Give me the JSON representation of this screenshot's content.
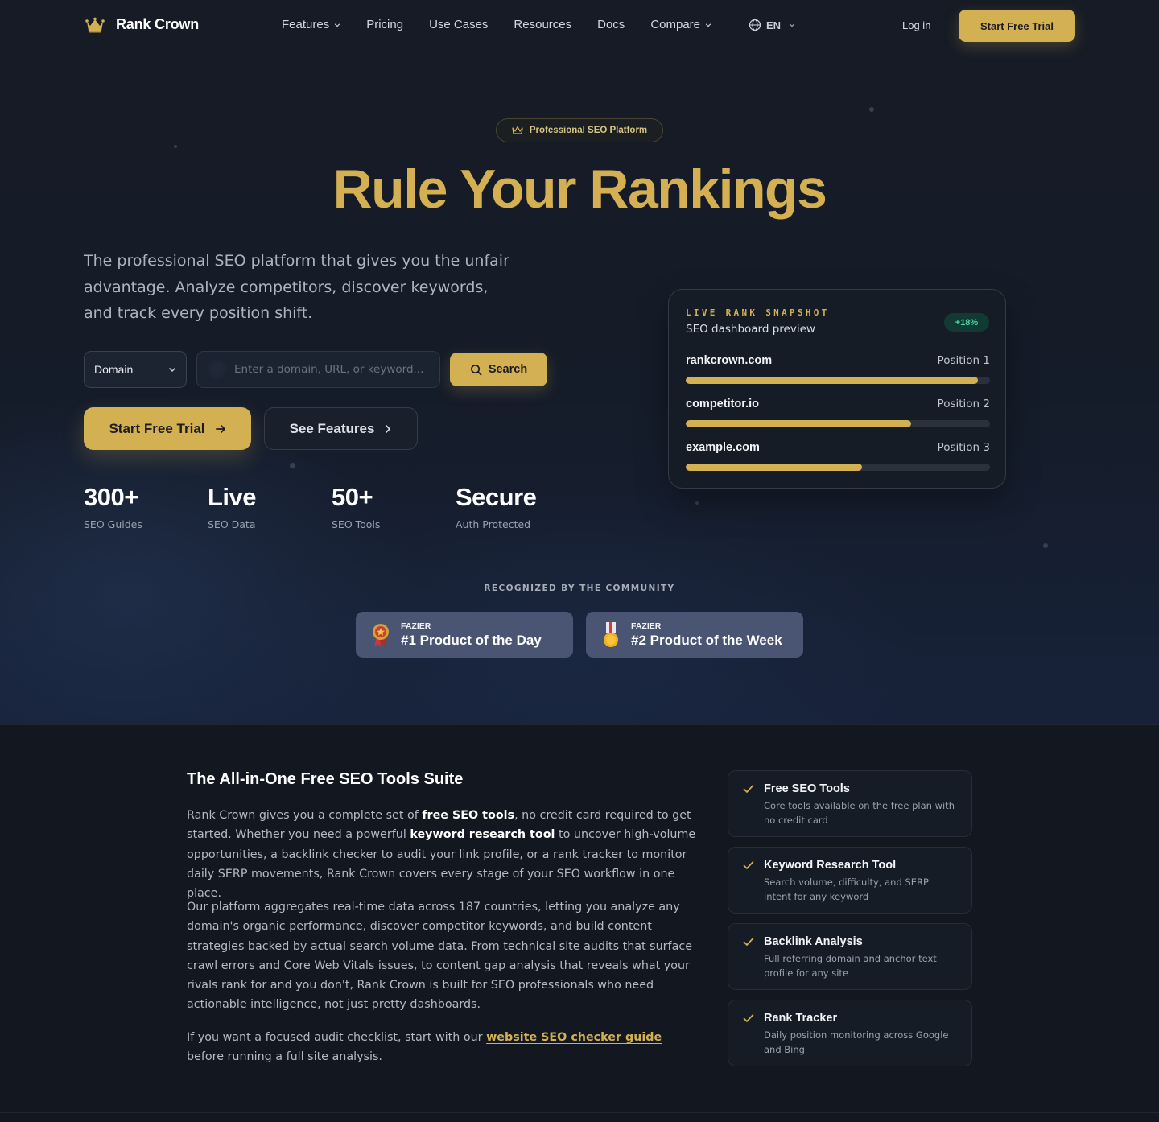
{
  "nav": {
    "brand": "Rank Crown",
    "links": [
      {
        "label": "Features",
        "dropdown": true
      },
      {
        "label": "Pricing",
        "dropdown": false
      },
      {
        "label": "Use Cases",
        "dropdown": false
      },
      {
        "label": "Resources",
        "dropdown": false
      },
      {
        "label": "Docs",
        "dropdown": false
      },
      {
        "label": "Compare",
        "dropdown": true
      }
    ],
    "language": "EN",
    "login": "Log in",
    "cta": "Start Free Trial"
  },
  "hero": {
    "badge": "Professional SEO Platform",
    "title": "Rule Your Rankings",
    "subtitle": "The professional SEO platform that gives you the unfair advantage. Analyze competitors, discover keywords, and track every position shift.",
    "search": {
      "type_selected": "Domain",
      "placeholder": "Enter a domain, URL, or keyword...",
      "button": "Search"
    },
    "cta_primary": "Start Free Trial",
    "cta_secondary": "See Features",
    "stats": [
      {
        "value": "300+",
        "label": "SEO Guides"
      },
      {
        "value": "Live",
        "label": "SEO Data"
      },
      {
        "value": "50+",
        "label": "SEO Tools"
      },
      {
        "value": "Secure",
        "label": "Auth Protected"
      }
    ]
  },
  "snapshot": {
    "kicker": "LIVE RANK SNAPSHOT",
    "title": "SEO dashboard preview",
    "change": "+18%",
    "rows": [
      {
        "domain": "rankcrown.com",
        "position": "Position 1",
        "score": 0.96
      },
      {
        "domain": "competitor.io",
        "position": "Position 2",
        "score": 0.74
      },
      {
        "domain": "example.com",
        "position": "Position 3",
        "score": 0.58
      }
    ]
  },
  "recognition": {
    "heading": "RECOGNIZED BY THE COMMUNITY",
    "awards": [
      {
        "org": "FAZIER",
        "title": "#1 Product of the Day",
        "icon": "award-rosette-icon"
      },
      {
        "org": "FAZIER",
        "title": "#2 Product of the Week",
        "icon": "medal-icon"
      }
    ]
  },
  "suite": {
    "title": "The All-in-One Free SEO Tools Suite",
    "p1": {
      "t1": "Rank Crown gives you a complete set of ",
      "b1": "free SEO tools",
      "t2": ", no credit card required to get started. Whether you need a powerful ",
      "b2": "keyword research tool",
      "t3": " to uncover high-volume opportunities, a backlink checker to audit your link profile, or a rank tracker to monitor daily SERP movements, Rank Crown covers every stage of your SEO workflow in one place."
    },
    "p2": "Our platform aggregates real-time data across 187 countries, letting you analyze any domain's organic performance, discover competitor keywords, and build content strategies backed by actual search volume data. From technical site audits that surface crawl errors and Core Web Vitals issues, to content gap analysis that reveals what your rivals rank for and you don't, Rank Crown is built for SEO professionals who need actionable intelligence, not just pretty dashboards.",
    "p3": {
      "t1": "If you want a focused audit checklist, start with our ",
      "link": "website SEO checker guide",
      "t2": " before running a full site analysis."
    },
    "features": [
      {
        "title": "Free SEO Tools",
        "desc": "Core tools available on the free plan with no credit card"
      },
      {
        "title": "Keyword Research Tool",
        "desc": "Search volume, difficulty, and SERP intent for any keyword"
      },
      {
        "title": "Backlink Analysis",
        "desc": "Full referring domain and anchor text profile for any site"
      },
      {
        "title": "Rank Tracker",
        "desc": "Daily position monitoring across Google and Bing"
      }
    ]
  },
  "colors": {
    "accent": "#d3b052",
    "background": "#151b25",
    "positive": "#4fd6a6"
  }
}
